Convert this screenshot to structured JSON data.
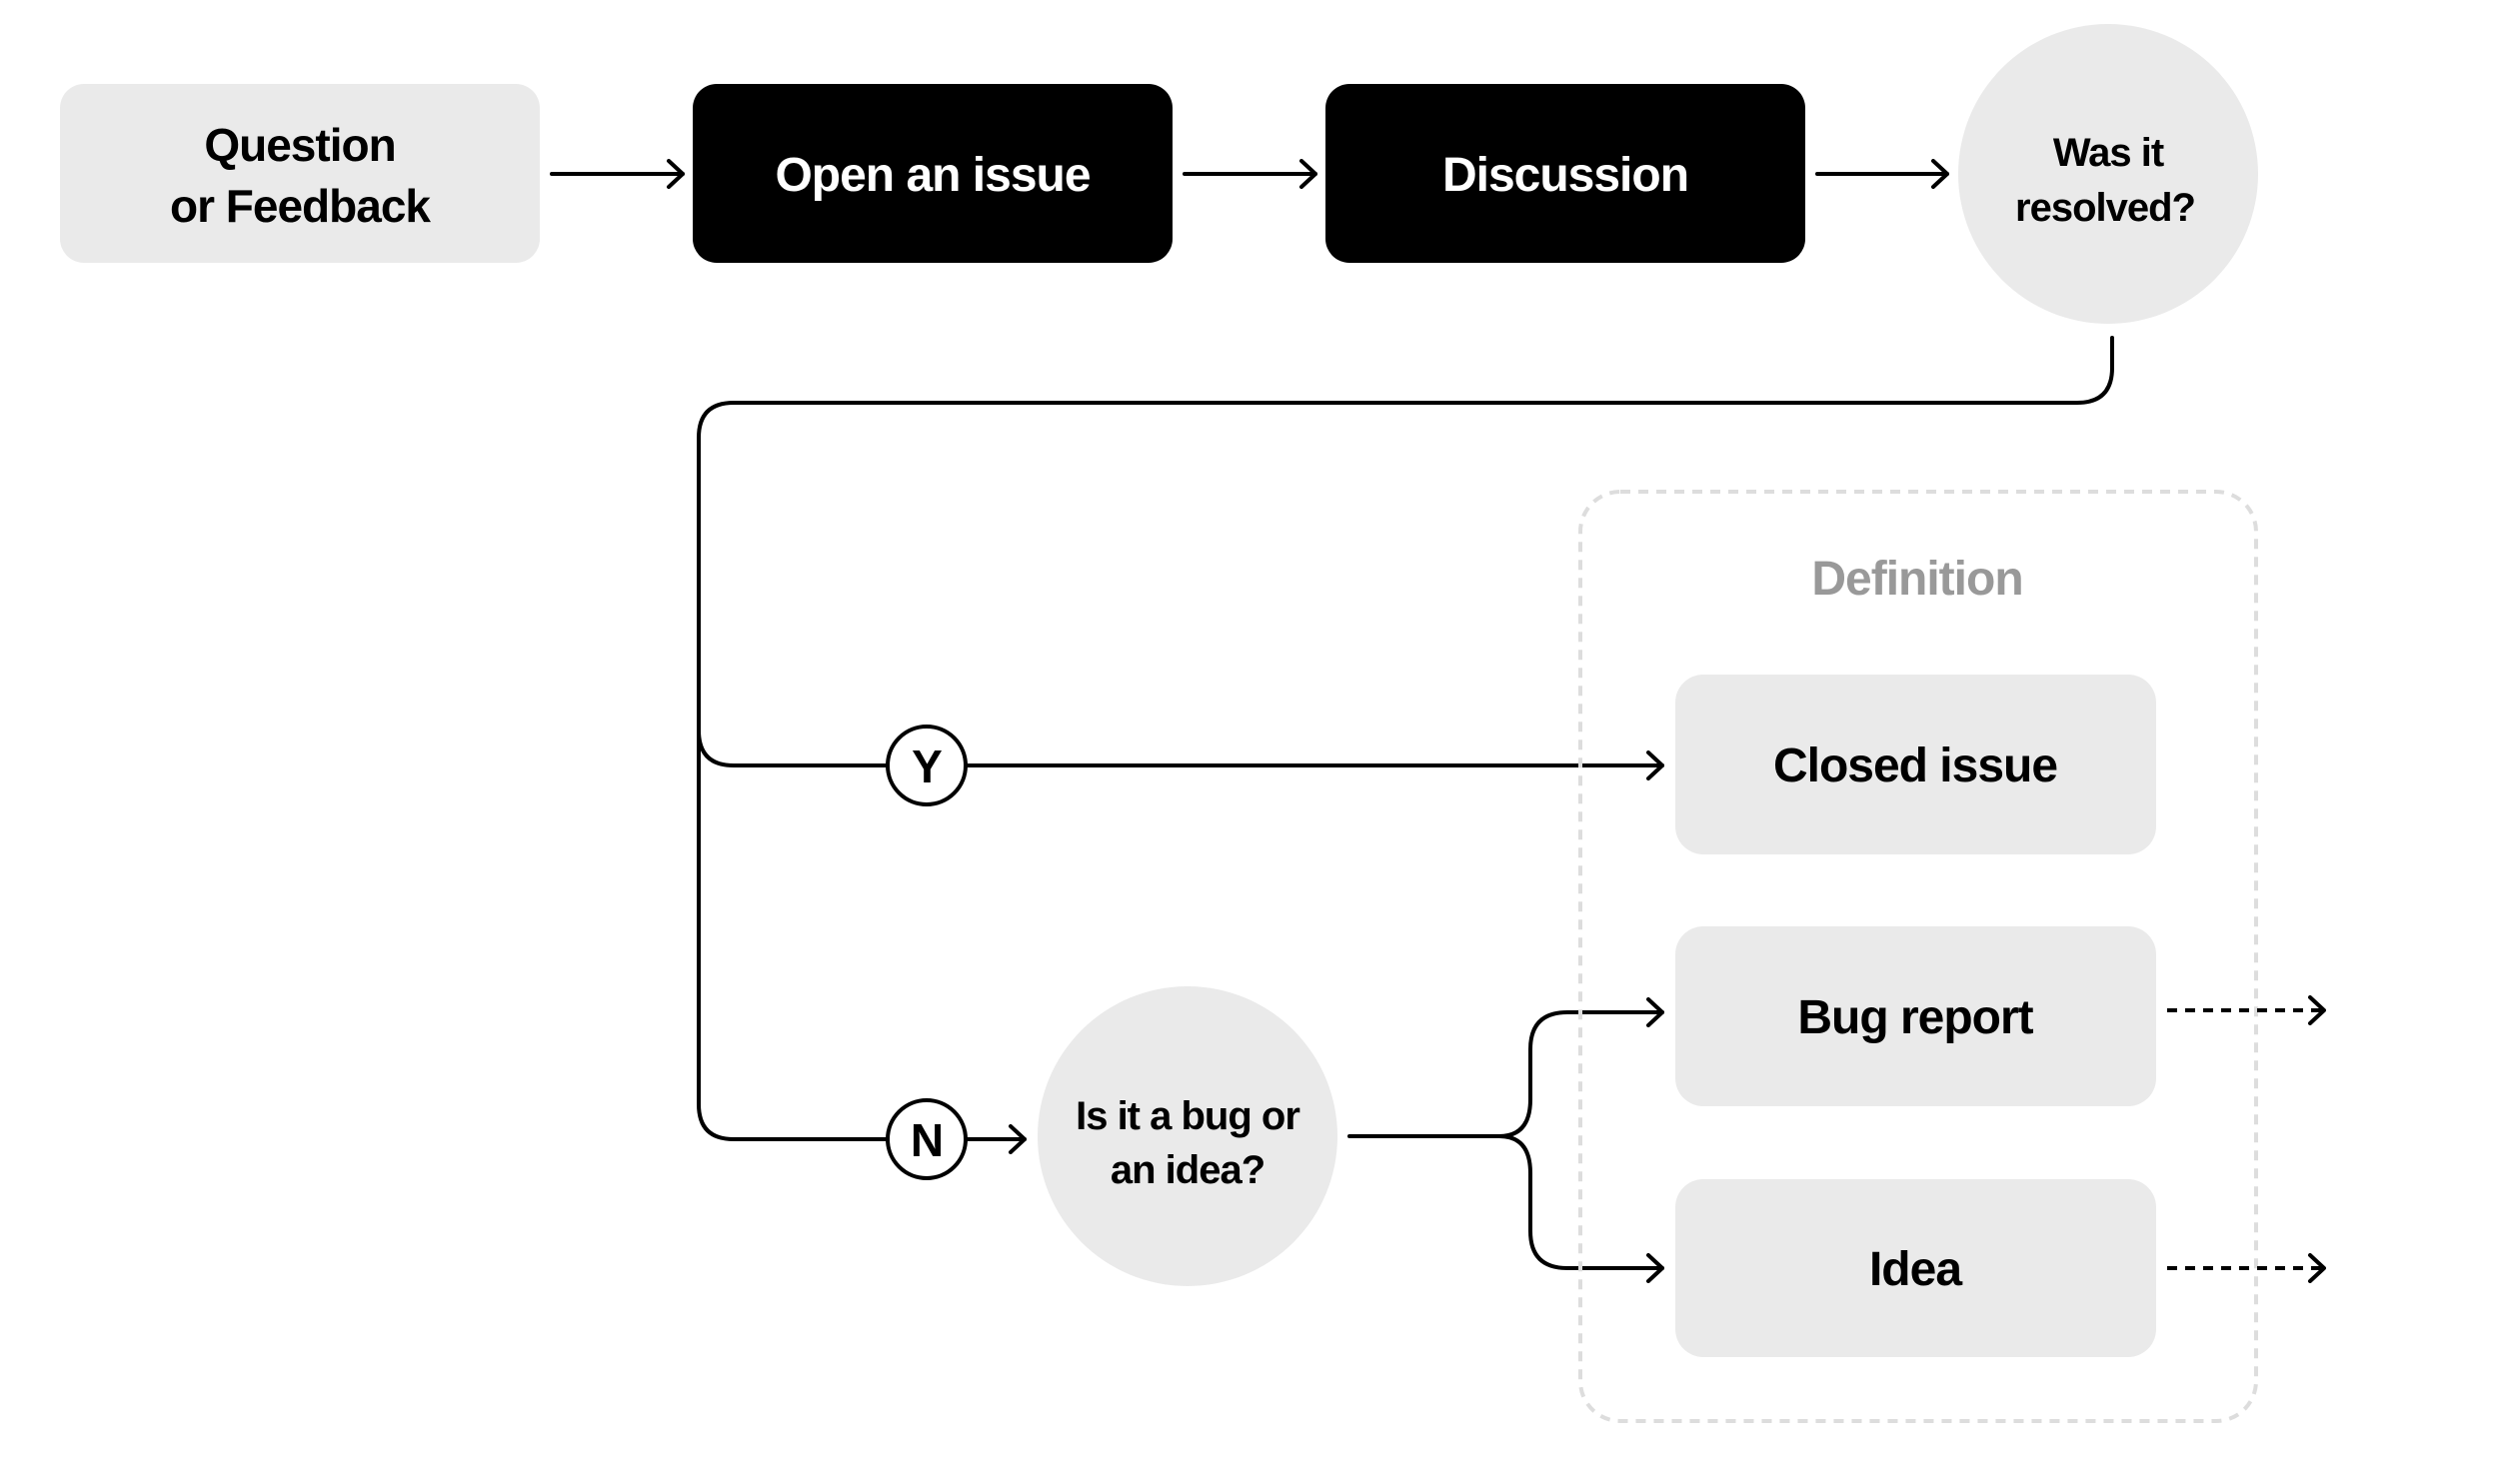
{
  "colors": {
    "light_fill": "#EAEAEA",
    "dark_fill": "#000000",
    "stroke": "#000000",
    "group_border": "#DDDDDD",
    "group_label": "#999999",
    "text_dark": "#000000",
    "text_light": "#FFFFFF"
  },
  "nodes": {
    "question": {
      "lines": [
        "Question",
        "or Feedback"
      ]
    },
    "open_issue": {
      "label": "Open an issue"
    },
    "discussion": {
      "label": "Discussion"
    },
    "resolved": {
      "lines": [
        "Was it",
        "resolved?"
      ]
    },
    "bug_or_idea": {
      "lines": [
        "Is it a bug or",
        "an idea?"
      ]
    }
  },
  "branches": {
    "yes": {
      "label": "Y"
    },
    "no": {
      "label": "N"
    }
  },
  "definition_group": {
    "title": "Definition",
    "items": [
      {
        "label": "Closed issue"
      },
      {
        "label": "Bug report"
      },
      {
        "label": "Idea"
      }
    ]
  }
}
